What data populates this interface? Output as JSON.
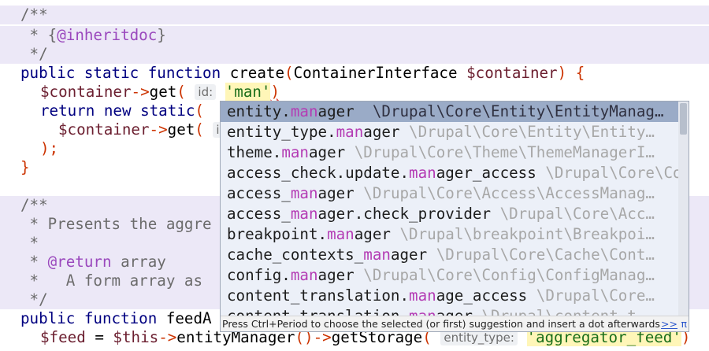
{
  "code": {
    "l1": "/**",
    "l2_pre": " * {",
    "l2_tag": "@inheritdoc",
    "l2_post": "}",
    "l3": " */",
    "l4_kw": "public static function",
    "l4_name": " create",
    "l4_open": "(",
    "l4_type": "ContainerInterface ",
    "l4_var": "$container",
    "l4_close": ") {",
    "l5_var": "$container",
    "l5_arrow": "->",
    "l5_call": "get",
    "l5_open": "( ",
    "l5_hint": "id:",
    "l5_str": "'man'",
    "l5_close": ")",
    "l6_kw": "return new static",
    "l6_open": "(",
    "l7_var": "$container",
    "l7_arrow": "->",
    "l7_call": "get",
    "l7_open": "( ",
    "l7_hint": "i",
    "l8": ");",
    "l9": "}",
    "l11": "/**",
    "l12": " * Presents the aggre",
    "l13": " *",
    "l14_pre": " * ",
    "l14_tag": "@return",
    "l14_post": " array",
    "l15": " *   A form array as",
    "l16": " */",
    "l17_kw": "public function",
    "l17_name": " feedA",
    "l18_var": "$feed",
    "l18_eq": " = ",
    "l18_this": "$this",
    "l18_arrow": "->",
    "l18_call": "entityManager",
    "l18_paren": "()",
    "l18_arrow2": "->",
    "l18_call2": "getStorage",
    "l18_open": "( ",
    "l18_hint": "entity_type:",
    "l18_str": "'aggregator_feed'",
    "l18_close": ")"
  },
  "completion": {
    "items": [
      {
        "pre": "entity.",
        "match": "man",
        "post": "ager",
        "type": "  \\Drupal\\Core\\Entity\\EntityManag…",
        "selected": true
      },
      {
        "pre": "entity_type.",
        "match": "man",
        "post": "ager",
        "type": " \\Drupal\\Core\\Entity\\Entity…"
      },
      {
        "pre": "theme.",
        "match": "man",
        "post": "ager",
        "type": " \\Drupal\\Core\\Theme\\ThemeManagerI…"
      },
      {
        "pre": "access_check.update.",
        "match": "man",
        "post": "ager_access",
        "type": " \\Drupal\\Core\\Cor…"
      },
      {
        "pre": "access_",
        "match": "man",
        "post": "ager",
        "type": " \\Drupal\\Core\\Access\\AccessManag…"
      },
      {
        "pre": "access_",
        "match": "man",
        "post": "ager.check_provider",
        "type": " \\Drupal\\Core\\Acc…"
      },
      {
        "pre": "breakpoint.",
        "match": "man",
        "post": "ager",
        "type": " \\Drupal\\breakpoint\\Breakpoi…"
      },
      {
        "pre": "cache_contexts_",
        "match": "man",
        "post": "ager",
        "type": " \\Drupal\\Core\\Cache\\Cont…"
      },
      {
        "pre": "config.",
        "match": "man",
        "post": "ager",
        "type": " \\Drupal\\Core\\Config\\ConfigManag…"
      },
      {
        "pre": "content_translation.",
        "match": "man",
        "post": "age_access",
        "type": " \\Drupal\\Core…"
      },
      {
        "pre": "content_translation.",
        "match": "man",
        "post": "ager",
        "type": " \\Drupal\\content_t…"
      }
    ],
    "footer_text": "Press Ctrl+Period to choose the selected (or first) suggestion and insert a dot afterwards",
    "footer_link": ">>",
    "footer_pi": "π"
  }
}
